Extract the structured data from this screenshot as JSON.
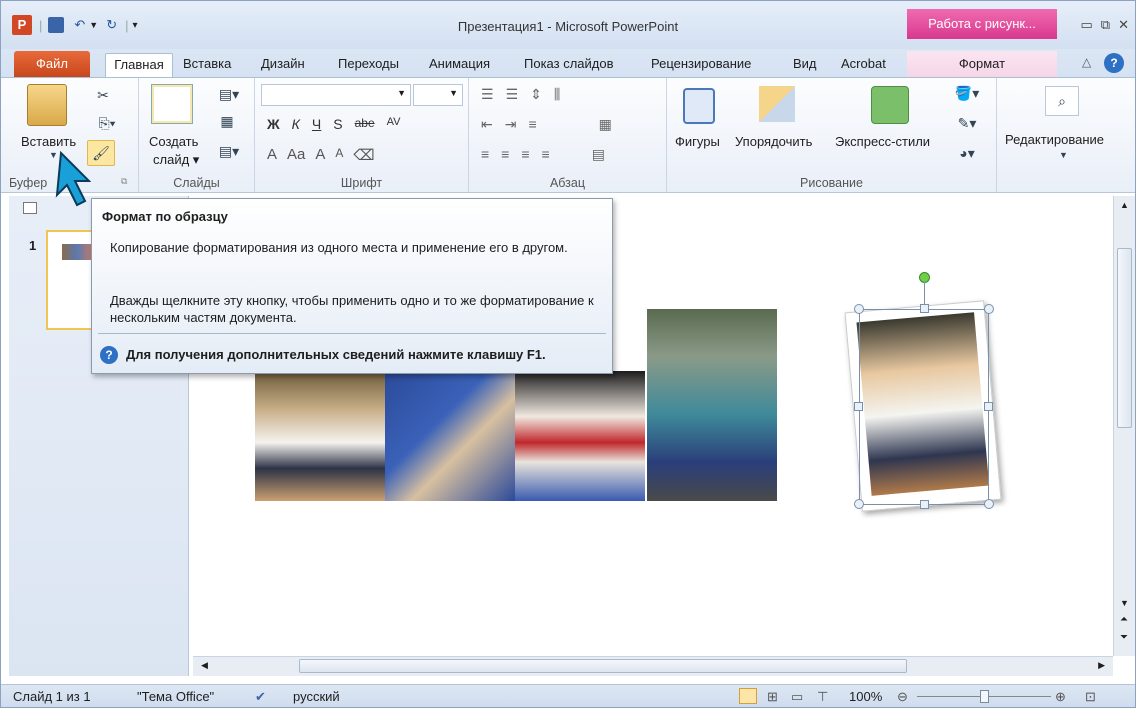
{
  "window": {
    "title": "Презентация1 - Microsoft PowerPoint",
    "context_tab_header": "Работа с рисунк...",
    "app_icon": "P"
  },
  "tabs": [
    {
      "label": "Файл"
    },
    {
      "label": "Главная"
    },
    {
      "label": "Вставка"
    },
    {
      "label": "Дизайн"
    },
    {
      "label": "Переходы"
    },
    {
      "label": "Анимация"
    },
    {
      "label": "Показ слайдов"
    },
    {
      "label": "Рецензирование"
    },
    {
      "label": "Вид"
    },
    {
      "label": "Acrobat"
    },
    {
      "label": "Формат"
    }
  ],
  "ribbon": {
    "clipboard": {
      "paste": "Вставить",
      "group": "Буфер о...",
      "group_display": "Буфер"
    },
    "slides": {
      "create": "Создать",
      "create2": "слайд",
      "group": "Слайды"
    },
    "font": {
      "group": "Шрифт",
      "bold": "Ж",
      "italic": "К",
      "underline": "Ч",
      "strike": "S",
      "strike2": "abe",
      "spacing": "AV",
      "color": "A",
      "case": "Aa",
      "grow": "A",
      "shrink": "A"
    },
    "paragraph": {
      "group": "Абзац"
    },
    "drawing": {
      "shapes": "Фигуры",
      "arrange": "Упорядочить",
      "quick_styles": "Экспресс-стили",
      "group": "Рисование"
    },
    "editing": {
      "label": "Редактирование"
    }
  },
  "thumbnail": {
    "number": "1"
  },
  "tooltip": {
    "title": "Формат по образцу",
    "line1": "Копирование форматирования из одного места и применение его в другом.",
    "line2": "Дважды щелкните эту кнопку, чтобы применить одно и то же форматирование к нескольким частям документа.",
    "help": "Для получения дополнительных сведений нажмите клавишу F1."
  },
  "status": {
    "slide": "Слайд 1 из 1",
    "theme": "\"Тема Office\"",
    "language": "русский",
    "zoom": "100%"
  },
  "colors": {
    "file_tab": "#d24726",
    "context_tab": "#e04a9a",
    "tooltip_border": "#8a9bb0",
    "accent_blue": "#2e70c4"
  }
}
